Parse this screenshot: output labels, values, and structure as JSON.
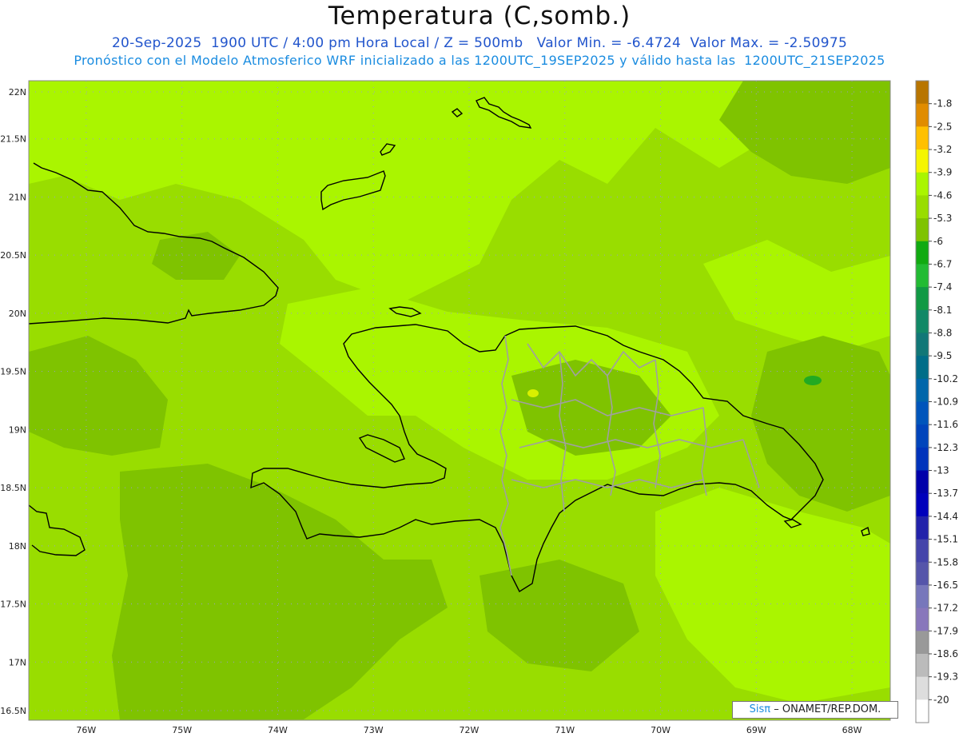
{
  "title": "Temperatura (C,somb.)",
  "subtitle1": "20-Sep-2025  1900 UTC / 4:00 pm Hora Local / Z = 500mb   Valor Min. = -6.4724  Valor Max. = -2.50975",
  "subtitle2": "Pronóstico con el Modelo Atmosferico WRF inicializado a las 1200UTC_19SEP2025 y válido hasta las  1200UTC_21SEP2025",
  "credit": {
    "brand": "Sisπ",
    "text": "– ONAMET/REP.DOM."
  },
  "map": {
    "lat_range": [
      16.5,
      22
    ],
    "lon_range": [
      -76.6,
      -67.6
    ],
    "lat_ticks": [
      "22N",
      "21.5N",
      "21N",
      "20.5N",
      "20N",
      "19.5N",
      "19N",
      "18.5N",
      "18N",
      "17.5N",
      "17N",
      "16.5N"
    ],
    "lon_ticks": [
      "76W",
      "75W",
      "74W",
      "73W",
      "72W",
      "71W",
      "70W",
      "69W",
      "68W"
    ],
    "dominant_value_range": [
      -5.3,
      -3.9
    ],
    "colors": {
      "field_base": "#99dd00",
      "field_light": "#aaf500",
      "field_dark": "#7fc300",
      "coastline": "#000000",
      "borders": "#a0a0a0",
      "grid": "#9a9ad0"
    }
  },
  "colorbar": {
    "labels": [
      "-1.8",
      "-2.5",
      "-3.2",
      "-3.9",
      "-4.6",
      "-5.3",
      "-6",
      "-6.7",
      "-7.4",
      "-8.1",
      "-8.8",
      "-9.5",
      "-10.2",
      "-10.9",
      "-11.6",
      "-12.3",
      "-13",
      "-13.7",
      "-14.4",
      "-15.1",
      "-15.8",
      "-16.5",
      "-17.2",
      "-17.9",
      "-18.6",
      "-19.3",
      "-20"
    ],
    "colors": [
      "#b87500",
      "#e08c00",
      "#ffc000",
      "#f5f500",
      "#aaf500",
      "#99dd00",
      "#7fc300",
      "#11aa11",
      "#22bb33",
      "#119944",
      "#118866",
      "#117777",
      "#006d88",
      "#0066aa",
      "#0055bb",
      "#0044bb",
      "#0033bb",
      "#0000aa",
      "#0000bb",
      "#2222aa",
      "#4444aa",
      "#5555aa",
      "#7777bb",
      "#8877bb",
      "#999999",
      "#bbbbbb",
      "#dddddd",
      "#ffffff"
    ]
  }
}
